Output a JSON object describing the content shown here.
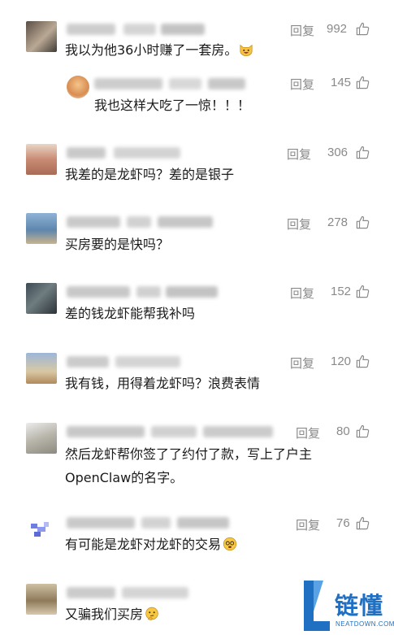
{
  "reply_label": "回复",
  "colors": {
    "accent": "#1f6fc3",
    "meta_gray": "#8a8a8a",
    "text": "#1a1a1a"
  },
  "comments": [
    {
      "text": "我以为他36小时赚了一套房。",
      "emoji": "grinning-cat-emoji",
      "likes": "992"
    },
    {
      "text": "我也这样大吃了一惊！！！",
      "likes": "145"
    },
    {
      "text": "我差的是龙虾吗？差的是银子",
      "likes": "306"
    },
    {
      "text": "买房要的是快吗？",
      "likes": "278"
    },
    {
      "text": "差的钱龙虾能帮我补吗",
      "likes": "152"
    },
    {
      "text": "我有钱，用得着龙虾吗？浪费表情",
      "likes": "120"
    },
    {
      "text_line1": "然后龙虾帮你签了了约付了款，写上了户主",
      "text_line2": "OpenClaw的名字。",
      "likes": "80"
    },
    {
      "text": "有可能是龙虾对龙虾的交易",
      "emoji": "dizzy-face-emoji",
      "likes": "76"
    },
    {
      "text": "又骗我们买房",
      "emoji": "thinking-face-emoji"
    }
  ],
  "watermark": {
    "chinese": "链懂",
    "english": "NEATDOWN.COM"
  }
}
